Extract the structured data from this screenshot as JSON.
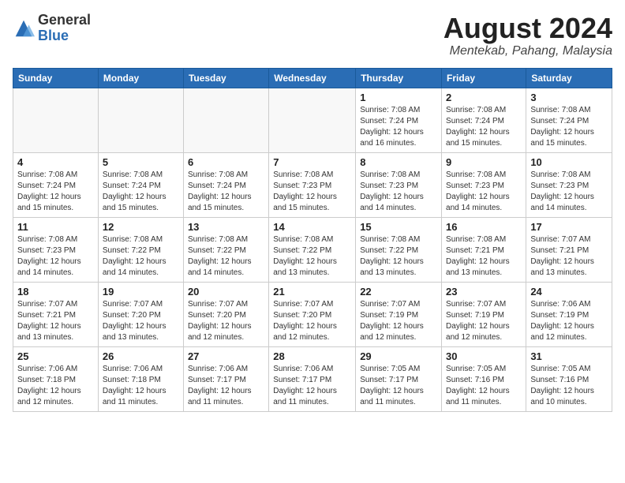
{
  "header": {
    "logo_general": "General",
    "logo_blue": "Blue",
    "month_year": "August 2024",
    "location": "Mentekab, Pahang, Malaysia"
  },
  "weekdays": [
    "Sunday",
    "Monday",
    "Tuesday",
    "Wednesday",
    "Thursday",
    "Friday",
    "Saturday"
  ],
  "weeks": [
    [
      {
        "day": "",
        "info": ""
      },
      {
        "day": "",
        "info": ""
      },
      {
        "day": "",
        "info": ""
      },
      {
        "day": "",
        "info": ""
      },
      {
        "day": "1",
        "info": "Sunrise: 7:08 AM\nSunset: 7:24 PM\nDaylight: 12 hours\nand 16 minutes."
      },
      {
        "day": "2",
        "info": "Sunrise: 7:08 AM\nSunset: 7:24 PM\nDaylight: 12 hours\nand 15 minutes."
      },
      {
        "day": "3",
        "info": "Sunrise: 7:08 AM\nSunset: 7:24 PM\nDaylight: 12 hours\nand 15 minutes."
      }
    ],
    [
      {
        "day": "4",
        "info": "Sunrise: 7:08 AM\nSunset: 7:24 PM\nDaylight: 12 hours\nand 15 minutes."
      },
      {
        "day": "5",
        "info": "Sunrise: 7:08 AM\nSunset: 7:24 PM\nDaylight: 12 hours\nand 15 minutes."
      },
      {
        "day": "6",
        "info": "Sunrise: 7:08 AM\nSunset: 7:24 PM\nDaylight: 12 hours\nand 15 minutes."
      },
      {
        "day": "7",
        "info": "Sunrise: 7:08 AM\nSunset: 7:23 PM\nDaylight: 12 hours\nand 15 minutes."
      },
      {
        "day": "8",
        "info": "Sunrise: 7:08 AM\nSunset: 7:23 PM\nDaylight: 12 hours\nand 14 minutes."
      },
      {
        "day": "9",
        "info": "Sunrise: 7:08 AM\nSunset: 7:23 PM\nDaylight: 12 hours\nand 14 minutes."
      },
      {
        "day": "10",
        "info": "Sunrise: 7:08 AM\nSunset: 7:23 PM\nDaylight: 12 hours\nand 14 minutes."
      }
    ],
    [
      {
        "day": "11",
        "info": "Sunrise: 7:08 AM\nSunset: 7:23 PM\nDaylight: 12 hours\nand 14 minutes."
      },
      {
        "day": "12",
        "info": "Sunrise: 7:08 AM\nSunset: 7:22 PM\nDaylight: 12 hours\nand 14 minutes."
      },
      {
        "day": "13",
        "info": "Sunrise: 7:08 AM\nSunset: 7:22 PM\nDaylight: 12 hours\nand 14 minutes."
      },
      {
        "day": "14",
        "info": "Sunrise: 7:08 AM\nSunset: 7:22 PM\nDaylight: 12 hours\nand 13 minutes."
      },
      {
        "day": "15",
        "info": "Sunrise: 7:08 AM\nSunset: 7:22 PM\nDaylight: 12 hours\nand 13 minutes."
      },
      {
        "day": "16",
        "info": "Sunrise: 7:08 AM\nSunset: 7:21 PM\nDaylight: 12 hours\nand 13 minutes."
      },
      {
        "day": "17",
        "info": "Sunrise: 7:07 AM\nSunset: 7:21 PM\nDaylight: 12 hours\nand 13 minutes."
      }
    ],
    [
      {
        "day": "18",
        "info": "Sunrise: 7:07 AM\nSunset: 7:21 PM\nDaylight: 12 hours\nand 13 minutes."
      },
      {
        "day": "19",
        "info": "Sunrise: 7:07 AM\nSunset: 7:20 PM\nDaylight: 12 hours\nand 13 minutes."
      },
      {
        "day": "20",
        "info": "Sunrise: 7:07 AM\nSunset: 7:20 PM\nDaylight: 12 hours\nand 12 minutes."
      },
      {
        "day": "21",
        "info": "Sunrise: 7:07 AM\nSunset: 7:20 PM\nDaylight: 12 hours\nand 12 minutes."
      },
      {
        "day": "22",
        "info": "Sunrise: 7:07 AM\nSunset: 7:19 PM\nDaylight: 12 hours\nand 12 minutes."
      },
      {
        "day": "23",
        "info": "Sunrise: 7:07 AM\nSunset: 7:19 PM\nDaylight: 12 hours\nand 12 minutes."
      },
      {
        "day": "24",
        "info": "Sunrise: 7:06 AM\nSunset: 7:19 PM\nDaylight: 12 hours\nand 12 minutes."
      }
    ],
    [
      {
        "day": "25",
        "info": "Sunrise: 7:06 AM\nSunset: 7:18 PM\nDaylight: 12 hours\nand 12 minutes."
      },
      {
        "day": "26",
        "info": "Sunrise: 7:06 AM\nSunset: 7:18 PM\nDaylight: 12 hours\nand 11 minutes."
      },
      {
        "day": "27",
        "info": "Sunrise: 7:06 AM\nSunset: 7:17 PM\nDaylight: 12 hours\nand 11 minutes."
      },
      {
        "day": "28",
        "info": "Sunrise: 7:06 AM\nSunset: 7:17 PM\nDaylight: 12 hours\nand 11 minutes."
      },
      {
        "day": "29",
        "info": "Sunrise: 7:05 AM\nSunset: 7:17 PM\nDaylight: 12 hours\nand 11 minutes."
      },
      {
        "day": "30",
        "info": "Sunrise: 7:05 AM\nSunset: 7:16 PM\nDaylight: 12 hours\nand 11 minutes."
      },
      {
        "day": "31",
        "info": "Sunrise: 7:05 AM\nSunset: 7:16 PM\nDaylight: 12 hours\nand 10 minutes."
      }
    ]
  ]
}
